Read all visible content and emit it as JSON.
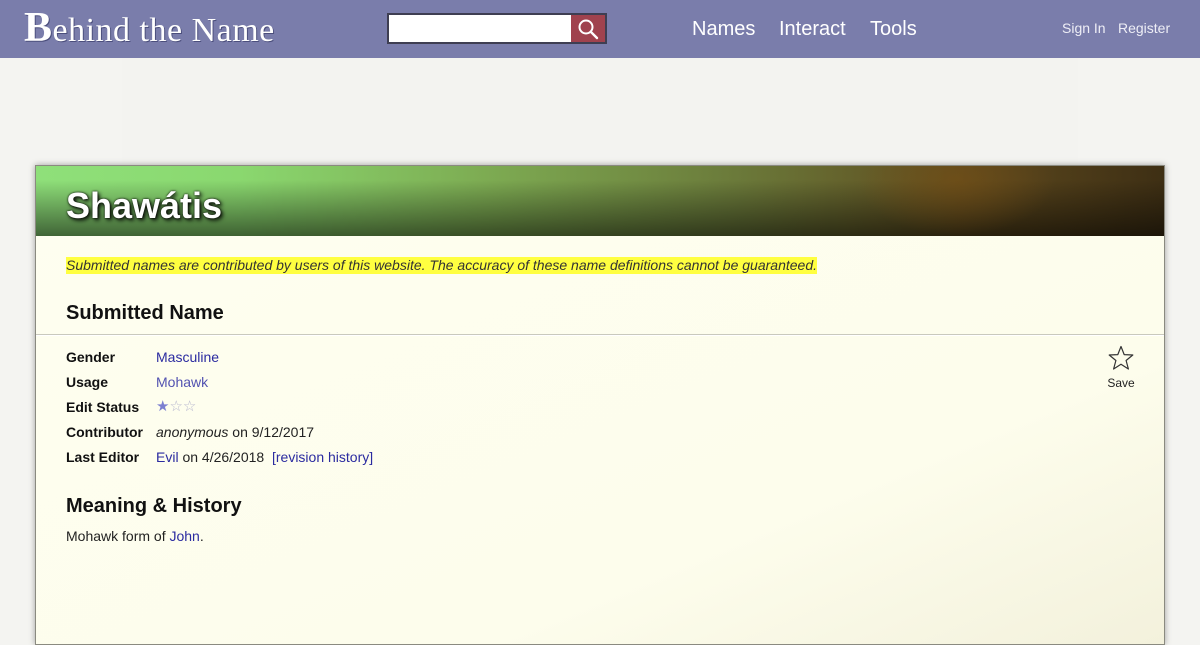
{
  "header": {
    "logo_first_letter": "B",
    "logo_rest": "ehind the Name",
    "search": {
      "value": "",
      "placeholder": ""
    },
    "nav": [
      "Names",
      "Interact",
      "Tools"
    ],
    "account": {
      "sign_in": "Sign In",
      "register": "Register"
    }
  },
  "page": {
    "title": "Shawátis",
    "disclaimer": "Submitted names are contributed by users of this website. The accuracy of these name definitions cannot be guaranteed.",
    "section_heading": "Submitted Name",
    "details": {
      "gender": {
        "label": "Gender",
        "value": "Masculine"
      },
      "usage": {
        "label": "Usage",
        "value": "Mohawk"
      },
      "edit_status": {
        "label": "Edit Status",
        "stars_filled": 1,
        "stars_total": 3
      },
      "contributor": {
        "label": "Contributor",
        "name": "anonymous",
        "date_text": " on 9/12/2017"
      },
      "last_editor": {
        "label": "Last Editor",
        "name": "Evil",
        "date_text": " on 4/26/2018 ",
        "history_link": "[revision history]"
      }
    },
    "save": {
      "label": "Save",
      "icon": "star-outline-icon"
    },
    "meaning_heading": "Meaning & History",
    "meaning": {
      "prefix": "Mohawk form of ",
      "link": "John",
      "suffix": "."
    }
  },
  "colors": {
    "header_bg": "#7a7dab",
    "search_button": "#a0424e",
    "disclaimer_highlight": "#ffff40",
    "link": "#2b2ba0"
  }
}
